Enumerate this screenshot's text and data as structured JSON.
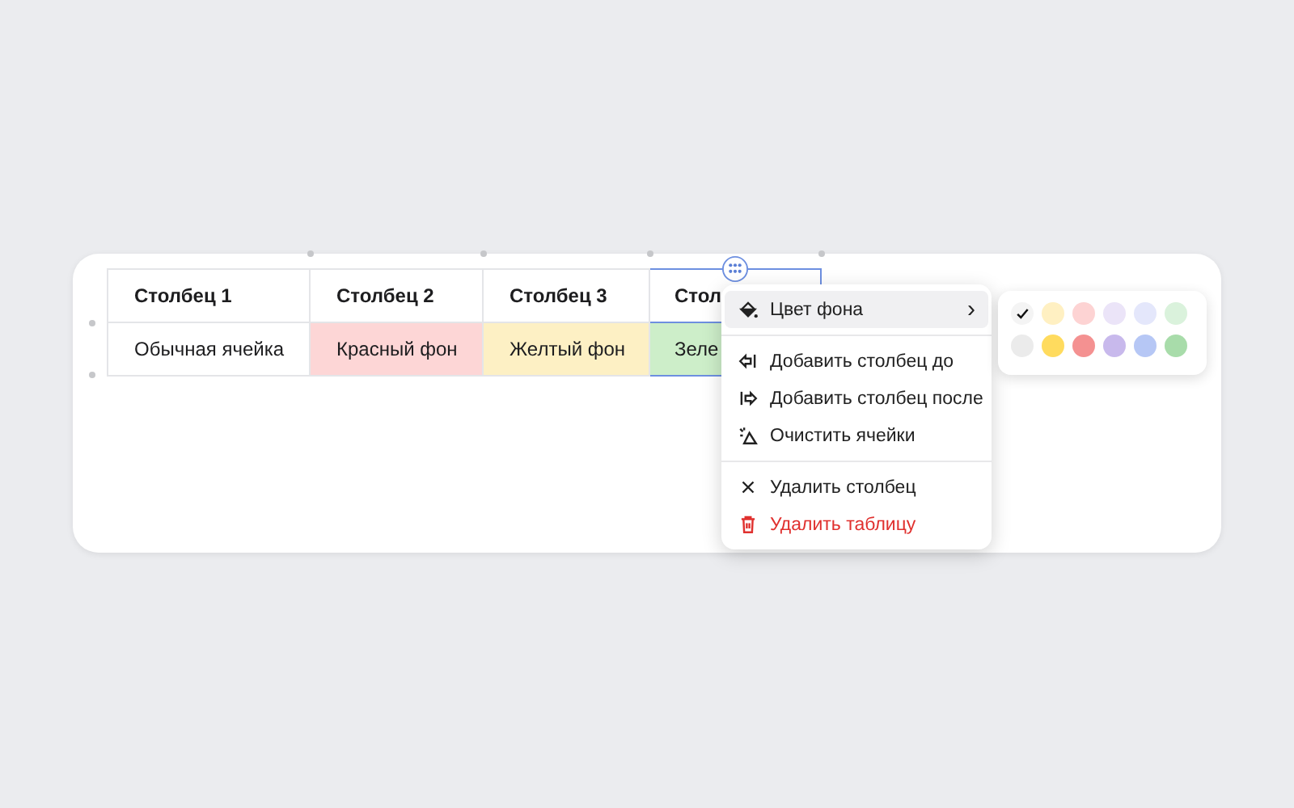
{
  "table": {
    "columns": [
      {
        "header": "Столбец 1",
        "selected": false
      },
      {
        "header": "Столбец 2",
        "selected": false
      },
      {
        "header": "Столбец 3",
        "selected": false
      },
      {
        "header": "Стол",
        "selected": true
      }
    ],
    "rows": [
      {
        "cells": [
          {
            "text": "Обычная ячейка"
          },
          {
            "text": "Красный фон",
            "color": "#fdd6d6"
          },
          {
            "text": "Желтый фон",
            "color": "#fdf0c4"
          },
          {
            "text": "Зеле",
            "color": "#cdeec9"
          }
        ]
      }
    ]
  },
  "context_menu": {
    "groups": [
      [
        {
          "kind": "submenu",
          "label": "Цвет фона",
          "selected": true,
          "arrow": "›"
        }
      ],
      [
        {
          "kind": "item",
          "label": "Добавить столбец до",
          "selected": false
        },
        {
          "kind": "item",
          "label": "Добавить столбец после",
          "selected": false
        },
        {
          "kind": "item",
          "label": "Очистить ячейки",
          "selected": false
        }
      ],
      [
        {
          "kind": "item",
          "label": "Удалить столбец",
          "selected": false
        },
        {
          "kind": "danger",
          "label": "Удалить таблицу",
          "selected": false
        }
      ]
    ]
  },
  "color_palette": {
    "rows": [
      [
        {
          "color": "#f4f4f4",
          "selected": true
        },
        {
          "color": "#fff0c2",
          "selected": false
        },
        {
          "color": "#fdd3d3",
          "selected": false
        },
        {
          "color": "#ebe4f8",
          "selected": false
        },
        {
          "color": "#e4e7fb",
          "selected": false
        },
        {
          "color": "#daf2dc",
          "selected": false
        }
      ],
      [
        {
          "color": "#ebebeb",
          "selected": false
        },
        {
          "color": "#ffdb5e",
          "selected": false
        },
        {
          "color": "#f49191",
          "selected": false
        },
        {
          "color": "#c8b9ec",
          "selected": false
        },
        {
          "color": "#b6c7f5",
          "selected": false
        },
        {
          "color": "#a8dcaa",
          "selected": false
        }
      ]
    ]
  }
}
